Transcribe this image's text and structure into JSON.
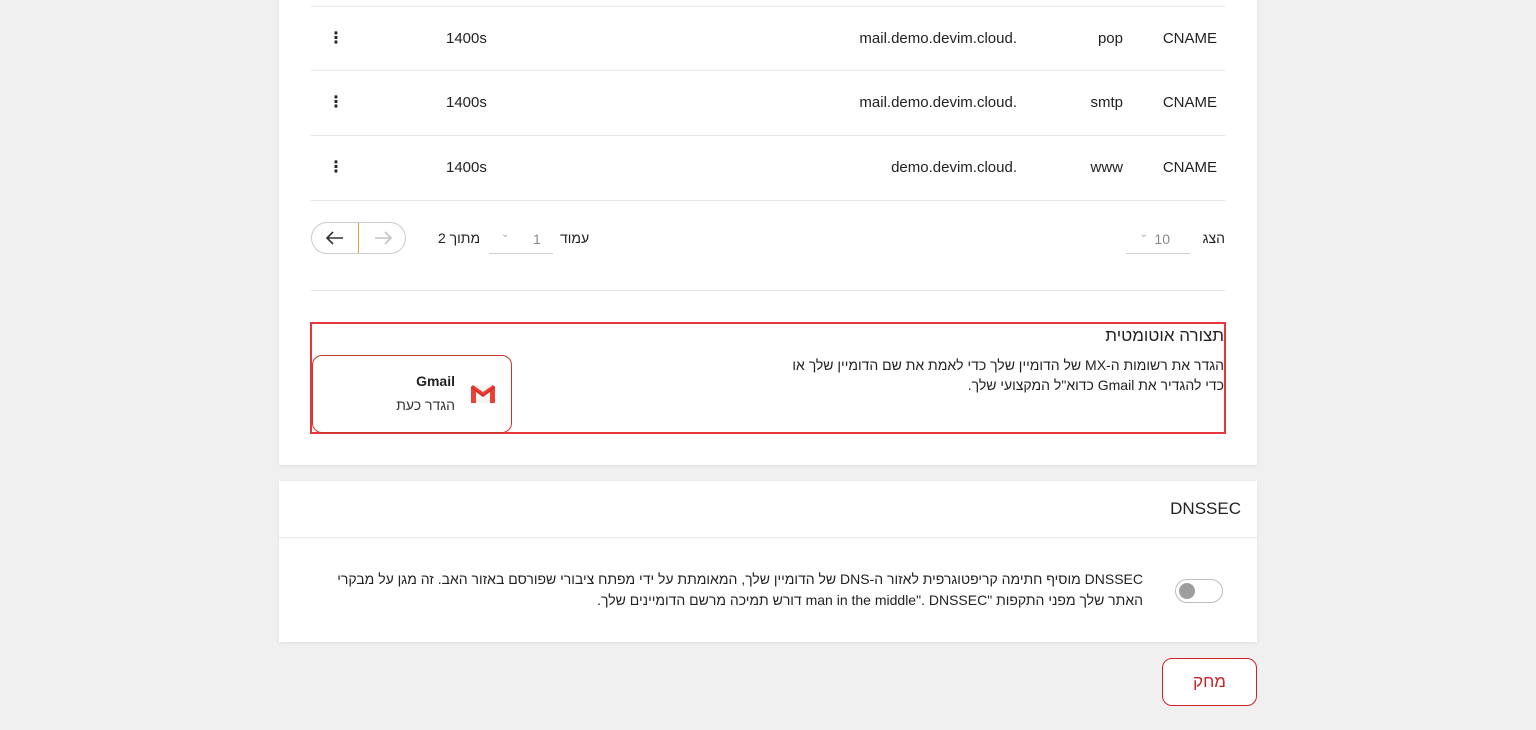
{
  "records": [
    {
      "type": "CNAME",
      "name": "pop",
      "value": "mail.demo.devim.cloud.",
      "ttl": "1400s"
    },
    {
      "type": "CNAME",
      "name": "smtp",
      "value": "mail.demo.devim.cloud.",
      "ttl": "1400s"
    },
    {
      "type": "CNAME",
      "name": "www",
      "value": "demo.devim.cloud.",
      "ttl": "1400s"
    }
  ],
  "row_menu_glyph": "⋮",
  "pagination": {
    "show_label": "הצג",
    "page_size": "10",
    "page_label": "עמוד",
    "page": "1",
    "of_label": "מתוך 2"
  },
  "auto_config": {
    "title": "תצורה אוטומטית",
    "description_line1": "הגדר את רשומות ה-MX של הדומיין שלך כדי לאמת את שם הדומיין שלך או",
    "description_line2": "כדי להגדיר את Gmail כדוא\"ל המקצועי שלך.",
    "gmail_title": "Gmail",
    "gmail_action": "הגדר כעת",
    "gmail_icon": "gmail-icon"
  },
  "dnssec": {
    "title": "DNSSEC",
    "description_line1": "DNSSEC מוסיף חתימה קריפטוגרפית לאזור ה-DNS של הדומיין שלך, המאומתת על ידי מפתח ציבורי שפורסם באזור האב. זה מגן על מבקרי",
    "description_line2": "האתר שלך מפני התקפות \"man in the middle\". DNSSEC דורש תמיכה מרשם הדומיינים שלך.",
    "enabled": false
  },
  "delete_label": "מחק",
  "colors": {
    "accent": "#e3a13a",
    "danger": "#d0202a",
    "highlight_border": "#e8353b",
    "gmail_red": "#ea4335"
  }
}
